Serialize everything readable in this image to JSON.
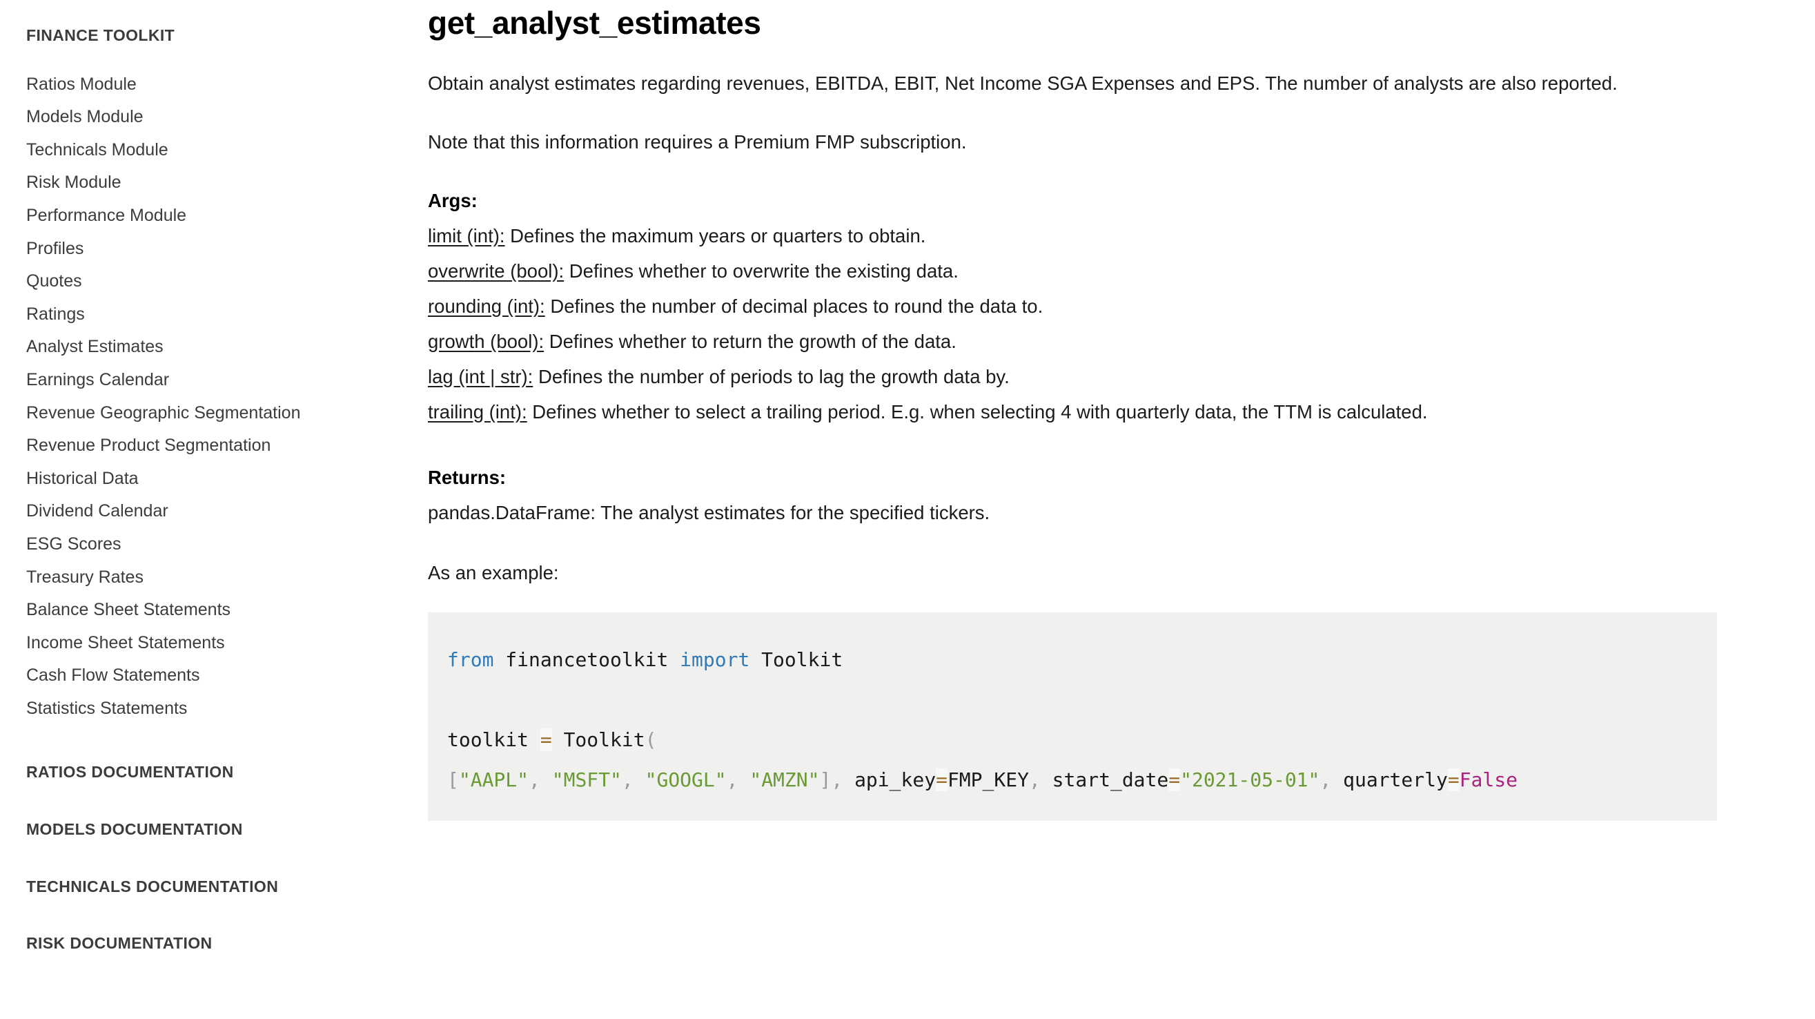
{
  "sidebar": {
    "title": "FINANCE TOOLKIT",
    "items": [
      {
        "label": "Ratios Module"
      },
      {
        "label": "Models Module"
      },
      {
        "label": "Technicals Module"
      },
      {
        "label": "Risk Module"
      },
      {
        "label": "Performance Module"
      },
      {
        "label": "Profiles"
      },
      {
        "label": "Quotes"
      },
      {
        "label": "Ratings"
      },
      {
        "label": "Analyst Estimates"
      },
      {
        "label": "Earnings Calendar"
      },
      {
        "label": "Revenue Geographic Segmentation"
      },
      {
        "label": "Revenue Product Segmentation"
      },
      {
        "label": "Historical Data"
      },
      {
        "label": "Dividend Calendar"
      },
      {
        "label": "ESG Scores"
      },
      {
        "label": "Treasury Rates"
      },
      {
        "label": "Balance Sheet Statements"
      },
      {
        "label": "Income Sheet Statements"
      },
      {
        "label": "Cash Flow Statements"
      },
      {
        "label": "Statistics Statements"
      }
    ],
    "sections": [
      {
        "label": "RATIOS DOCUMENTATION"
      },
      {
        "label": "MODELS DOCUMENTATION"
      },
      {
        "label": "TECHNICALS DOCUMENTATION"
      },
      {
        "label": "RISK DOCUMENTATION"
      }
    ]
  },
  "main": {
    "title": "get_analyst_estimates",
    "intro": "Obtain analyst estimates regarding revenues, EBITDA, EBIT, Net Income SGA Expenses and EPS. The number of analysts are also reported.",
    "note": "Note that this information requires a Premium FMP subscription.",
    "args_heading": "Args:",
    "args": [
      {
        "name": "limit (int):",
        "desc": "Defines the maximum years or quarters to obtain."
      },
      {
        "name": "overwrite (bool):",
        "desc": "Defines whether to overwrite the existing data."
      },
      {
        "name": "rounding (int):",
        "desc": "Defines the number of decimal places to round the data to."
      },
      {
        "name": "growth (bool):",
        "desc": "Defines whether to return the growth of the data."
      },
      {
        "name": "lag (int | str):",
        "desc": "Defines the number of periods to lag the growth data by."
      },
      {
        "name": "trailing (int):",
        "desc": "Defines whether to select a trailing period. E.g. when selecting 4 with quarterly data, the TTM is calculated."
      }
    ],
    "returns_heading": "Returns:",
    "returns_text": "pandas.DataFrame: The analyst estimates for the specified tickers.",
    "example_label": "As an example:",
    "code": {
      "language": "python",
      "tokens": [
        {
          "t": "from",
          "c": "kw"
        },
        {
          "t": " financetoolkit ",
          "c": "plain"
        },
        {
          "t": "import",
          "c": "kw"
        },
        {
          "t": " Toolkit\n\n",
          "c": "plain"
        },
        {
          "t": "toolkit ",
          "c": "plain"
        },
        {
          "t": "=",
          "c": "op"
        },
        {
          "t": " Toolkit",
          "c": "plain"
        },
        {
          "t": "(",
          "c": "punc"
        },
        {
          "t": "\n",
          "c": "plain"
        },
        {
          "t": "[",
          "c": "punc"
        },
        {
          "t": "\"AAPL\"",
          "c": "str"
        },
        {
          "t": ",",
          "c": "punc"
        },
        {
          "t": " ",
          "c": "plain"
        },
        {
          "t": "\"MSFT\"",
          "c": "str"
        },
        {
          "t": ",",
          "c": "punc"
        },
        {
          "t": " ",
          "c": "plain"
        },
        {
          "t": "\"GOOGL\"",
          "c": "str"
        },
        {
          "t": ",",
          "c": "punc"
        },
        {
          "t": " ",
          "c": "plain"
        },
        {
          "t": "\"AMZN\"",
          "c": "str"
        },
        {
          "t": "]",
          "c": "punc"
        },
        {
          "t": ",",
          "c": "punc"
        },
        {
          "t": " api_key",
          "c": "plain"
        },
        {
          "t": "=",
          "c": "op"
        },
        {
          "t": "FMP_KEY",
          "c": "plain"
        },
        {
          "t": ",",
          "c": "punc"
        },
        {
          "t": " start_date",
          "c": "plain"
        },
        {
          "t": "=",
          "c": "op"
        },
        {
          "t": "\"2021-05-01\"",
          "c": "str"
        },
        {
          "t": ",",
          "c": "punc"
        },
        {
          "t": " quarterly",
          "c": "plain"
        },
        {
          "t": "=",
          "c": "op"
        },
        {
          "t": "False",
          "c": "bool"
        }
      ]
    }
  },
  "colors": {
    "code_background": "#f0f0ee",
    "keyword": "#2f7ab8",
    "string": "#6a9a35",
    "boolean": "#a8247f",
    "operator": "#9a6a28",
    "punctuation": "#9a9a9a",
    "text": "#1b1b1b",
    "sidebar_text": "#3c3c3c"
  }
}
